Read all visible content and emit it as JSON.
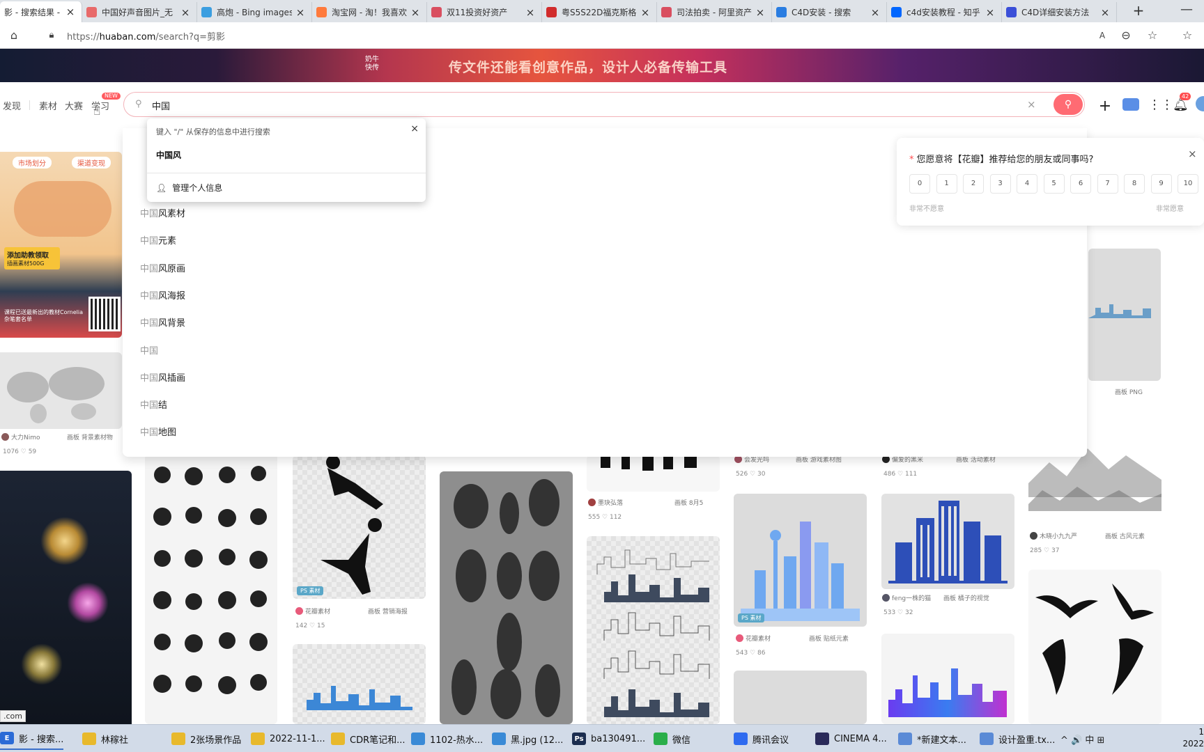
{
  "browser": {
    "tabs": [
      {
        "title": "影 - 搜索结果 - 花",
        "active": true,
        "color": "#ffffff"
      },
      {
        "title": "中国好声音图片_无",
        "color": "#e86a6a"
      },
      {
        "title": "高炮 - Bing images",
        "color": "#3b9ee0"
      },
      {
        "title": "淘宝网 - 淘！我喜欢",
        "color": "#ff7a3c"
      },
      {
        "title": "双11投资好资产",
        "color": "#d94f60"
      },
      {
        "title": "粤S5S22D福克斯格",
        "color": "#d12c2c"
      },
      {
        "title": "司法拍卖 - 阿里资产",
        "color": "#d94f60"
      },
      {
        "title": "C4D安装 - 搜索",
        "color": "#2a7de1"
      },
      {
        "title": "c4d安装教程 - 知乎",
        "color": "#0066ff"
      },
      {
        "title": "C4D详细安装方法",
        "color": "#3b4fd8"
      }
    ],
    "new_tab": "+",
    "url_prefix": "https://",
    "url_host": "huaban.com",
    "url_path": "/search?q=剪影",
    "window_min": "—"
  },
  "banner": {
    "logo_text": "奶牛\n快传",
    "text": "传文件还能看创意作品，设计人必备传输工具"
  },
  "nav": {
    "links": [
      "发现",
      "素材",
      "大赛",
      "学习"
    ],
    "learn_badge": "NEW",
    "notif_count": "42"
  },
  "search": {
    "value": "中国",
    "clear": "×"
  },
  "autofill": {
    "hint": "键入 \"/\" 从保存的信息中进行搜索",
    "item": "中国风",
    "manage": "管理个人信息",
    "close": "×"
  },
  "suggestions": [
    {
      "hl": "中国",
      "rest": "风素材"
    },
    {
      "hl": "中国",
      "rest": "元素"
    },
    {
      "hl": "中国",
      "rest": "风原画"
    },
    {
      "hl": "中国",
      "rest": "风海报"
    },
    {
      "hl": "中国",
      "rest": "风背景"
    },
    {
      "hl": "中国",
      "rest": ""
    },
    {
      "hl": "中国",
      "rest": "风插画"
    },
    {
      "hl": "中国",
      "rest": "结"
    },
    {
      "hl": "中国",
      "rest": "地图"
    }
  ],
  "survey": {
    "question": "您愿意将【花瓣】推荐给您的朋友或同事吗?",
    "scores": [
      "0",
      "1",
      "2",
      "3",
      "4",
      "5",
      "6",
      "7",
      "8",
      "9",
      "10"
    ],
    "low_label": "非常不愿意",
    "high_label": "非常愿意",
    "close": "×"
  },
  "ad": {
    "tag1": "市场划分",
    "tag2": "渠道变现",
    "btn": "添加助教领取",
    "btn_sub": "插画素材500G",
    "text": "课程已送最新出的教材Cornelia杂笔套名单"
  },
  "cards": {
    "worldmap_user": "大力Nimo",
    "worldmap_board": "画板 背景素材物",
    "worldmap_stats": "1076 ♡ 59",
    "jump_user": "花瓣素材",
    "jump_board": "画板 营销海报",
    "jump_stats": "142 ♡ 15",
    "jump_tag": "PS 素材",
    "silh_user": "墨玦弘落",
    "silh_board": "画板 8月5",
    "silh_stats": "555 ♡ 112",
    "sh_user": "花瓣素材",
    "sh_board": "画板 贴纸元素",
    "sh_stats": "543 ♡ 86",
    "sh_tag": "PS 素材",
    "g1_user": "会发光吗",
    "g1_board": "画板 游戏素材图",
    "g1_stats": "526 ♡ 30",
    "g2_user": "偏爱的黑米",
    "g2_board": "画板 活动素材",
    "g2_stats": "486 ♡ 111",
    "city_user": "feng一株的猫",
    "city_board": "画板 橘子的视觉",
    "city_stats": "533 ♡ 32",
    "mtn_user": "木晓小九九严",
    "mtn_board": "画板 古风元素",
    "mtn_stats": "285 ♡ 37",
    "png_board": "画板 PNG"
  },
  "taskbar": {
    "items": [
      {
        "label": "影 - 搜索...",
        "color": "#2b6bd6",
        "icon": "E"
      },
      {
        "label": "林稼社",
        "color": "#e8b92c",
        "icon": ""
      },
      {
        "label": "2张场景作品",
        "color": "#e8b92c",
        "icon": ""
      },
      {
        "label": "2022-11-1...",
        "color": "#e8b92c",
        "icon": ""
      },
      {
        "label": "CDR笔记和...",
        "color": "#e8b92c",
        "icon": ""
      },
      {
        "label": "1102-热水...",
        "color": "#3a8ad6",
        "icon": ""
      },
      {
        "label": "黑.jpg (12...",
        "color": "#3a8ad6",
        "icon": ""
      },
      {
        "label": "ba130491...",
        "color": "#1b2d4f",
        "icon": "Ps"
      },
      {
        "label": "微信",
        "color": "#2aae4a",
        "icon": ""
      },
      {
        "label": "腾讯会议",
        "color": "#2f6bf0",
        "icon": ""
      },
      {
        "label": "CINEMA 4...",
        "color": "#2a2a5a",
        "icon": ""
      },
      {
        "label": "*新建文本...",
        "color": "#5a8ad6",
        "icon": ""
      },
      {
        "label": "设计盈重.tx...",
        "color": "#5a8ad6",
        "icon": ""
      }
    ],
    "tray": "^ 🔊 中 ⊞",
    "clock_time": "1",
    "clock_date": "2022"
  },
  "status_url": ".com"
}
